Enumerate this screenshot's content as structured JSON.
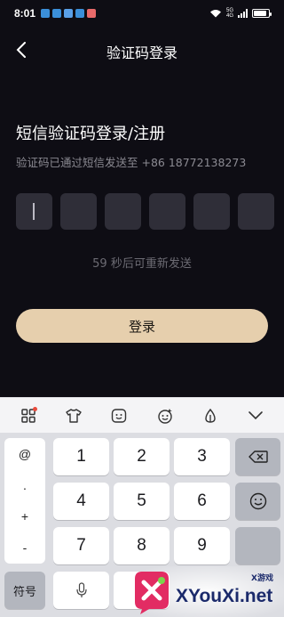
{
  "status": {
    "time": "8:01",
    "net": "5G",
    "net_sub": "4G"
  },
  "header": {
    "title": "验证码登录"
  },
  "main": {
    "heading": "短信验证码登录/注册",
    "sent_to": "验证码已通过短信发送至 +86 18772138273",
    "code_boxes": [
      "",
      "",
      "",
      "",
      "",
      ""
    ],
    "resend": "59 秒后可重新发送",
    "login_label": "登录"
  },
  "keyboard": {
    "toolbar": [
      "grid-icon",
      "tshirt-icon",
      "emoji-face-icon",
      "sticker-icon",
      "handwrite-icon",
      "collapse-chevron-icon"
    ],
    "symbols": [
      "@",
      ".",
      "+",
      "-"
    ],
    "digits": [
      "1",
      "2",
      "3",
      "4",
      "5",
      "6",
      "7",
      "8",
      "9",
      "0"
    ],
    "symbols_key": "符号"
  },
  "watermark": {
    "brand": "XYouXi.net",
    "tag": "X游戏"
  },
  "colors": {
    "background": "#0e0d14",
    "accent": "#e6cfad",
    "code_box": "#2f2e38"
  }
}
